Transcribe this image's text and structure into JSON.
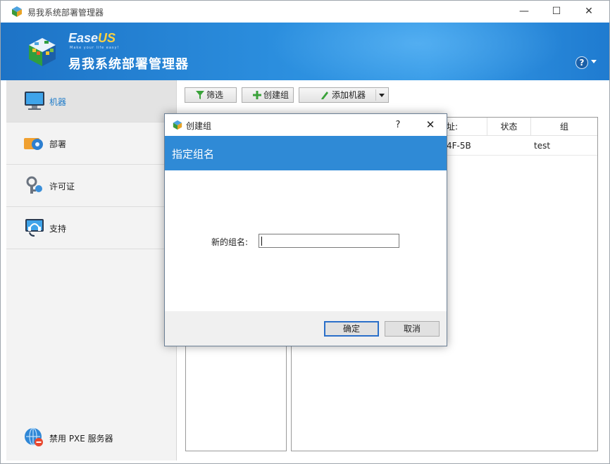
{
  "window": {
    "title": "易我系统部署管理器",
    "controls": {
      "minimize": "—",
      "maximize": "☐",
      "close": "✕"
    }
  },
  "banner": {
    "brand_main": "Ease",
    "brand_accent": "US",
    "brand_tagline": "Make your life easy!",
    "product_name": "易我系统部署管理器",
    "help_label": "?"
  },
  "sidebar": {
    "items": [
      {
        "label": "机器",
        "icon": "monitor-icon",
        "active": true
      },
      {
        "label": "部署",
        "icon": "deploy-icon",
        "active": false
      },
      {
        "label": "许可证",
        "icon": "license-key-icon",
        "active": false
      },
      {
        "label": "支持",
        "icon": "support-headset-icon",
        "active": false
      }
    ],
    "pxe_label": "禁用 PXE 服务器"
  },
  "toolbar": {
    "filter_label": "筛选",
    "create_group_label": "创建组",
    "add_machine_label": "添加机器"
  },
  "machine_list": {
    "columns": [
      "址:",
      "状态",
      "组"
    ],
    "rows": [
      {
        "address": "4F-5B",
        "status": "",
        "group": "test"
      }
    ]
  },
  "dialog": {
    "title": "创建组",
    "help": "?",
    "close": "✕",
    "header": "指定组名",
    "field_label": "新的组名:",
    "field_value": "",
    "ok_label": "确定",
    "cancel_label": "取消"
  },
  "colors": {
    "banner_blue": "#2b8ede",
    "dialog_header": "#2f8ad6",
    "active_sidebar_text": "#1e7bc9",
    "brand_accent": "#ffd23f"
  }
}
